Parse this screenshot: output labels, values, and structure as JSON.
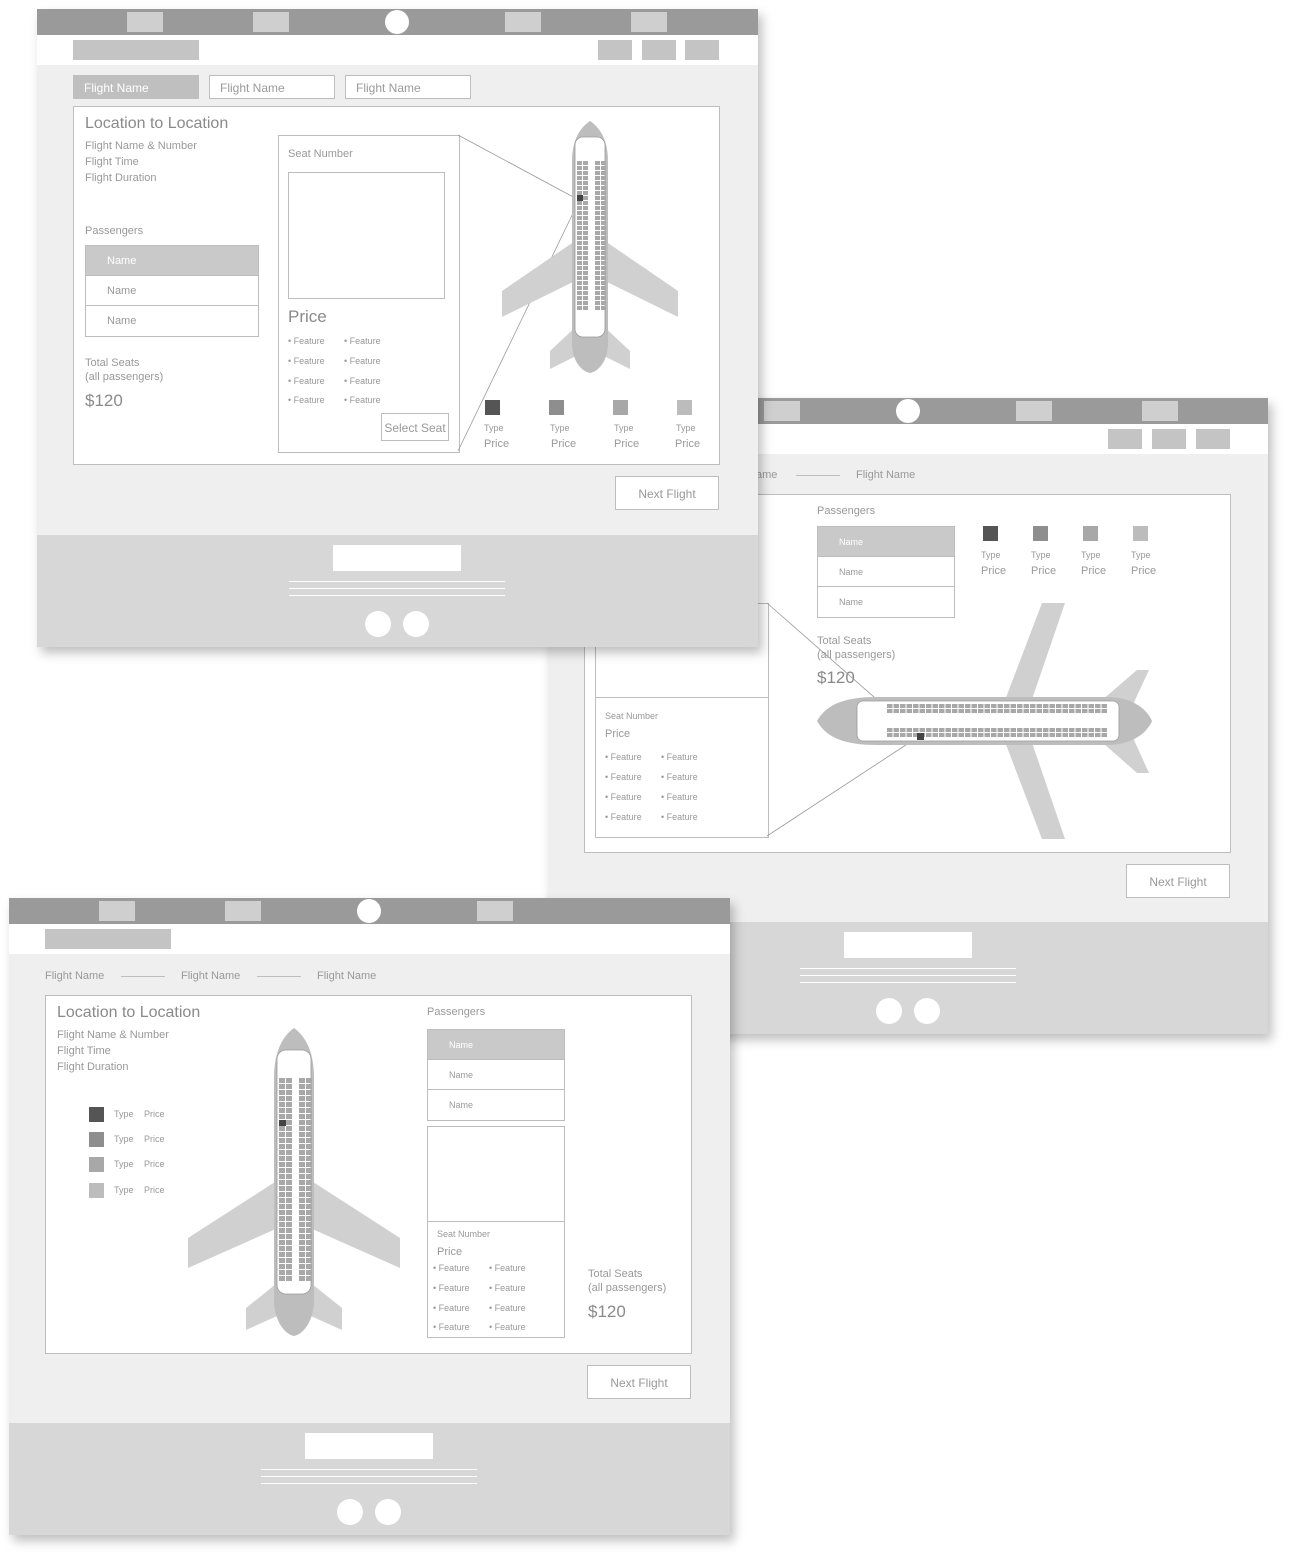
{
  "colors": {
    "dark": "#555555",
    "mid": "#8e8e8e",
    "light": "#a8a8a8",
    "lighter": "#bcbcbc"
  },
  "screen1": {
    "tabs": [
      "Flight Name",
      "Flight Name",
      "Flight Name"
    ],
    "route": "Location to Location",
    "flight_info": [
      "Flight Name & Number",
      "Flight Time",
      "Flight Duration"
    ],
    "passengers_label": "Passengers",
    "passengers": [
      "Name",
      "Name",
      "Name"
    ],
    "total_label": [
      "Total Seats",
      "(all passengers)"
    ],
    "total_price": "$120",
    "seat_label": "Seat Number",
    "price_label": "Price",
    "features": [
      "• Feature",
      "• Feature",
      "• Feature",
      "• Feature",
      "• Feature",
      "• Feature",
      "• Feature",
      "• Feature"
    ],
    "select_seat": "Select Seat",
    "legend": [
      {
        "type": "Type",
        "price": "Price"
      },
      {
        "type": "Type",
        "price": "Price"
      },
      {
        "type": "Type",
        "price": "Price"
      },
      {
        "type": "Type",
        "price": "Price"
      }
    ],
    "next": "Next Flight"
  },
  "screen2": {
    "breadcrumb": [
      "ame",
      "Flight Name"
    ],
    "passengers_label": "Passengers",
    "passengers": [
      "Name",
      "Name",
      "Name"
    ],
    "legend": [
      {
        "type": "Type",
        "price": "Price"
      },
      {
        "type": "Type",
        "price": "Price"
      },
      {
        "type": "Type",
        "price": "Price"
      },
      {
        "type": "Type",
        "price": "Price"
      }
    ],
    "total_label": [
      "Total Seats",
      "(all passengers)"
    ],
    "total_price": "$120",
    "seat_label": "Seat Number",
    "price_label": "Price",
    "features": [
      "• Feature",
      "• Feature",
      "• Feature",
      "• Feature",
      "• Feature",
      "• Feature",
      "• Feature",
      "• Feature"
    ],
    "next": "Next Flight"
  },
  "screen3": {
    "breadcrumb": [
      "Flight Name",
      "Flight Name",
      "Flight Name"
    ],
    "route": "Location to Location",
    "flight_info": [
      "Flight Name & Number",
      "Flight Time",
      "Flight Duration"
    ],
    "legend": [
      {
        "type": "Type",
        "price": "Price"
      },
      {
        "type": "Type",
        "price": "Price"
      },
      {
        "type": "Type",
        "price": "Price"
      },
      {
        "type": "Type",
        "price": "Price"
      }
    ],
    "passengers_label": "Passengers",
    "passengers": [
      "Name",
      "Name",
      "Name"
    ],
    "seat_label": "Seat Number",
    "price_label": "Price",
    "features": [
      "• Feature",
      "• Feature",
      "• Feature",
      "• Feature",
      "• Feature",
      "• Feature",
      "• Feature",
      "• Feature"
    ],
    "total_label": [
      "Total Seats",
      "(all passengers)"
    ],
    "total_price": "$120",
    "next": "Next Flight"
  }
}
